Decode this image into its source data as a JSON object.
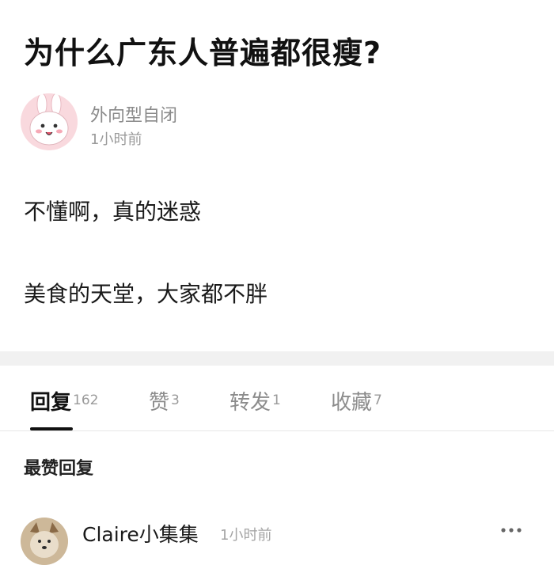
{
  "post": {
    "title": "为什么广东人普遍都很瘦?",
    "author": "外向型自闭",
    "time": "1小时前",
    "body_lines": [
      "不懂啊，真的迷惑",
      "美食的天堂，大家都不胖"
    ]
  },
  "tabs": [
    {
      "label": "回复",
      "count": "162",
      "active": true
    },
    {
      "label": "赞",
      "count": "3"
    },
    {
      "label": "转发",
      "count": "1"
    },
    {
      "label": "收藏",
      "count": "7"
    }
  ],
  "section": {
    "heading": "最赞回复"
  },
  "reply": {
    "author": "Claire小集集",
    "time": "1小时前",
    "more_icon": "more-horizontal-icon"
  },
  "colors": {
    "active_tab": "#111111",
    "inactive_tab": "#8c8c8c",
    "divider": "#f1f1f1"
  }
}
